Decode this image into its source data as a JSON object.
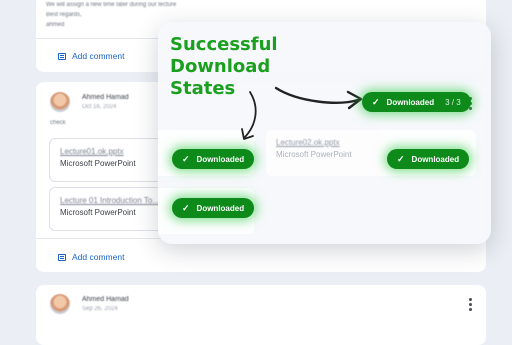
{
  "top_card": {
    "lines": [
      "We will assign a new time later during our lecture",
      "Best regards,",
      "ahmed"
    ],
    "add_comment": "Add comment"
  },
  "post": {
    "author": "Ahmed Hamad",
    "date": "Oct 16, 2024",
    "text": "check",
    "attachments": [
      {
        "title": "Lecture01.ok.pptx",
        "type": "Microsoft PowerPoint"
      },
      {
        "title": "Lecture 01 Introduction To...",
        "type": "Microsoft PowerPoint"
      }
    ],
    "add_comment": "Add comment"
  },
  "panel": {
    "title_lines": [
      "Successful",
      "Download",
      "States"
    ],
    "ghost_file": {
      "title": "Lecture02.ok.pptx",
      "type": "Microsoft PowerPoint"
    },
    "main_pill": {
      "label": "Downloaded",
      "count": "3 / 3"
    },
    "pills": [
      "Downloaded",
      "Downloaded",
      "Downloaded"
    ]
  },
  "bottom_card": {
    "author": "Ahmed Hamad",
    "date": "Sep 26, 2024"
  },
  "colors": {
    "accent_green": "#1aa01e",
    "pill_green": "#0d8a1a",
    "link_blue": "#1a62c7"
  },
  "icons": [
    "comment-icon",
    "check-icon",
    "more-vert-icon",
    "curved-arrow-icon"
  ]
}
